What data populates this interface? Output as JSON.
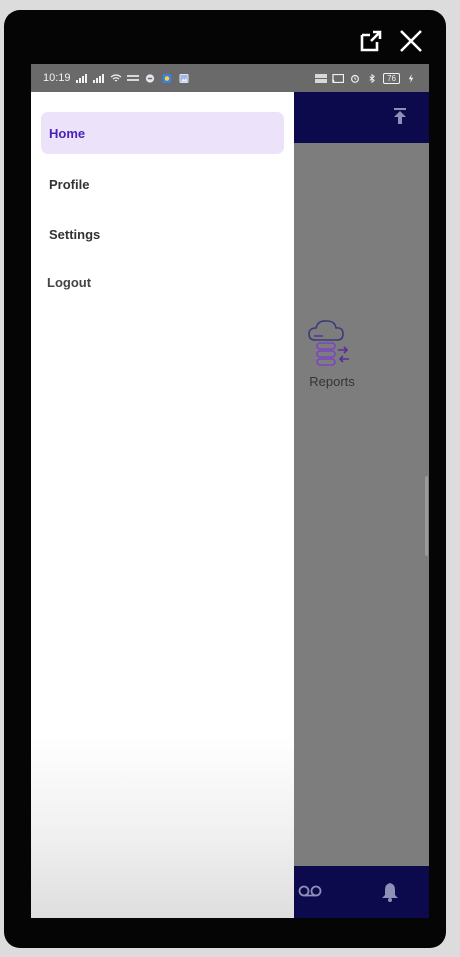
{
  "status_bar": {
    "time": "10:19",
    "battery": "76"
  },
  "drawer": {
    "items": [
      {
        "label": "Home",
        "active": true
      },
      {
        "label": "Profile",
        "active": false
      },
      {
        "label": "Settings",
        "active": false
      },
      {
        "label": "Logout",
        "active": false
      }
    ]
  },
  "main": {
    "tiles": [
      {
        "label": "Reports",
        "icon": "cloud-database-icon"
      }
    ]
  },
  "colors": {
    "header": "#0c0a4d",
    "active_item_bg": "#ece3fb",
    "active_item_text": "#4b22b8",
    "scrim": "#7d7d7d"
  },
  "icons": {
    "frame": [
      "open-external-icon",
      "close-icon"
    ],
    "header": [
      "scroll-to-top-icon"
    ],
    "bottom_nav": [
      "voicemail-icon",
      "bell-icon"
    ]
  }
}
